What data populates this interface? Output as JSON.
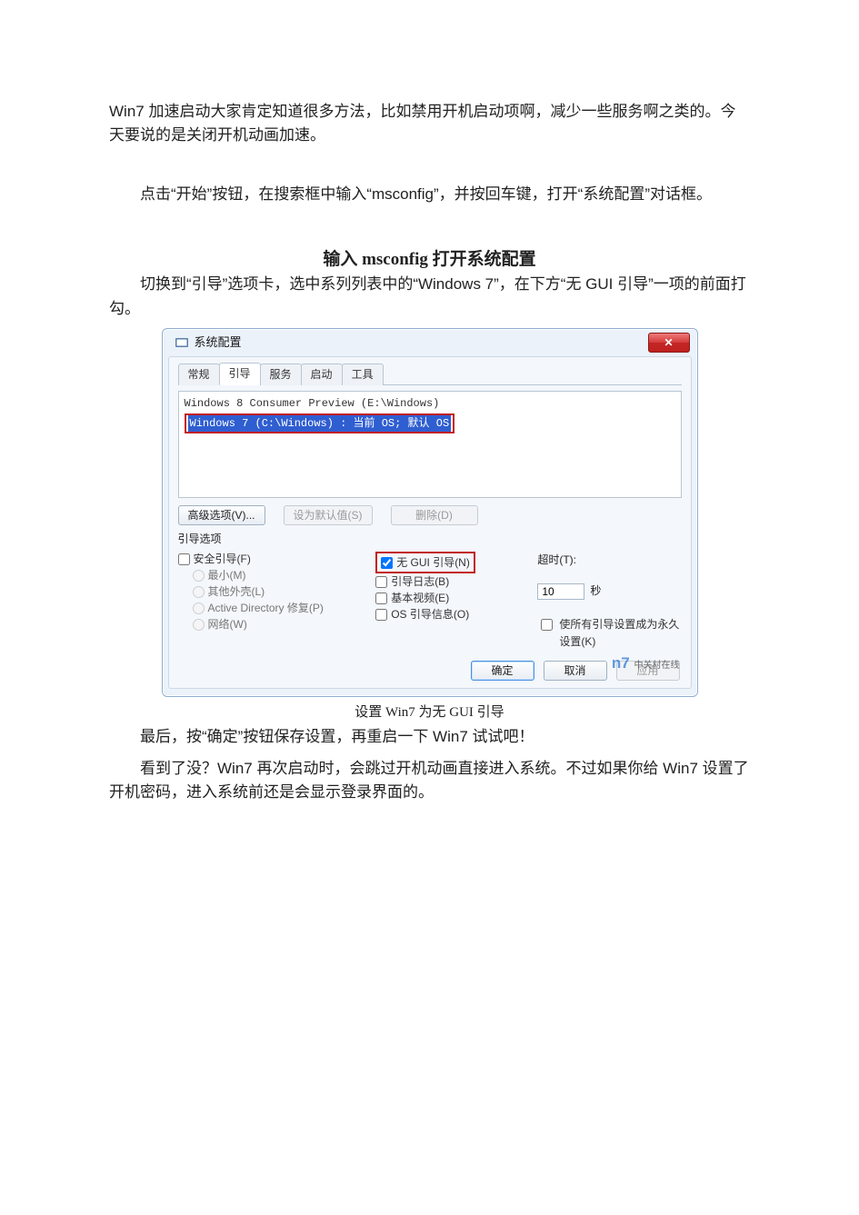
{
  "article": {
    "p1": "Win7 加速启动大家肯定知道很多方法，比如禁用开机启动项啊，减少一些服务啊之类的。今天要说的是关闭开机动画加速。",
    "p2": "点击“开始”按钮，在搜索框中输入“msconfig”，并按回车键，打开“系统配置”对话框。",
    "heading1": "输入 msconfig 打开系统配置",
    "p3": "切换到“引导”选项卡，选中系列列表中的“Windows 7”，在下方“无 GUI 引导”一项的前面打勾。",
    "caption1": "设置 Win7 为无 GUI 引导",
    "p4": "最后，按“确定”按钮保存设置，再重启一下 Win7 试试吧！",
    "p5": "看到了没？Win7 再次启动时，会跳过开机动画直接进入系统。不过如果你给 Win7 设置了开机密码，进入系统前还是会显示登录界面的。"
  },
  "dialog": {
    "title": "系统配置",
    "tabs": [
      "常规",
      "引导",
      "服务",
      "启动",
      "工具"
    ],
    "active_tab_index": 1,
    "oslist": {
      "row1": "Windows 8 Consumer Preview (E:\\Windows)",
      "row2": "Windows 7 (C:\\Windows) : 当前 OS; 默认 OS"
    },
    "buttons_row": {
      "advanced": "高级选项(V)...",
      "set_default": "设为默认值(S)",
      "delete": "删除(D)"
    },
    "boot_options_title": "引导选项",
    "left": {
      "safe_boot": "安全引导(F)",
      "min": "最小(M)",
      "altshell": "其他外壳(L)",
      "ad_repair": "Active Directory 修复(P)",
      "network": "网络(W)"
    },
    "mid": {
      "no_gui": "无 GUI 引导(N)",
      "bootlog": "引导日志(B)",
      "basevideo": "基本视频(E)",
      "osinfo": "OS 引导信息(O)"
    },
    "right": {
      "timeout_label": "超时(T):",
      "timeout_value": "10",
      "timeout_unit": "秒",
      "permanent": "使所有引导设置成为永久设置(K)"
    },
    "footer": {
      "ok": "确定",
      "cancel": "取消",
      "apply": "应用"
    },
    "watermark_big": "n7",
    "watermark_small": "中关村在线"
  }
}
